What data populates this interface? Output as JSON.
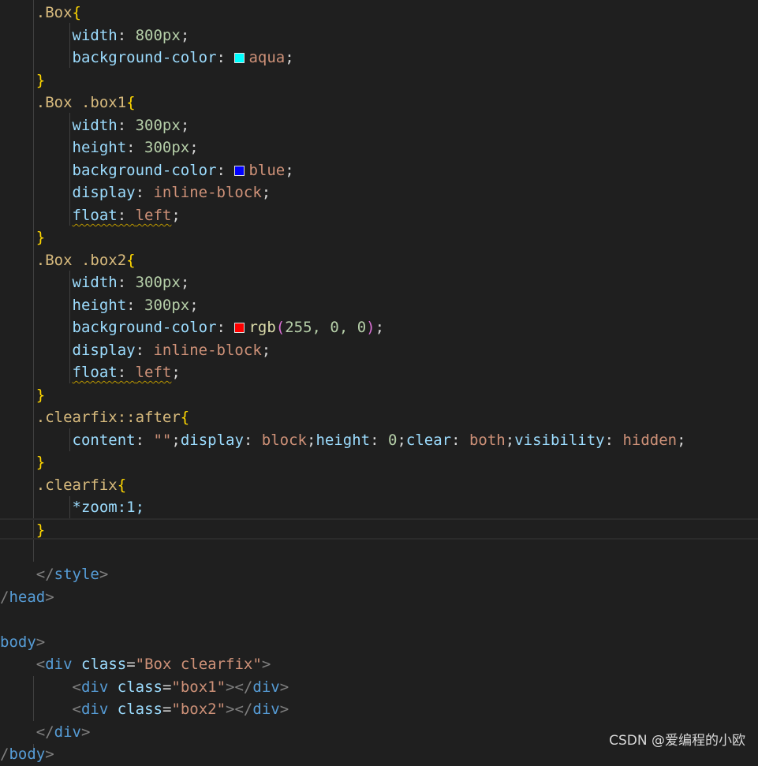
{
  "code": {
    "box_selector": ".Box",
    "width_prop": "width",
    "width_800": "800px",
    "bgcolor_prop": "background-color",
    "aqua": "aqua",
    "box1_selector": ".Box .box1",
    "height_prop": "height",
    "v300": "300px",
    "blue": "blue",
    "display_prop": "display",
    "inline_block": "inline-block",
    "float_prop": "float",
    "left": "left",
    "box2_selector": ".Box .box2",
    "rgb_fn": "rgb",
    "rgb_args": "255, 0, 0",
    "clearfix_after_selector": ".clearfix::after",
    "content_prop": "content",
    "empty_str": "\"\"",
    "block": "block",
    "zero": "0",
    "clear_prop": "clear",
    "both": "both",
    "visibility_prop": "visibility",
    "hidden": "hidden",
    "clearfix_selector": ".clearfix",
    "zoom_line": "*zoom:1;",
    "style_tag": "style",
    "head_tag": "head",
    "body_tag": "body",
    "div_tag": "div",
    "class_attr": "class",
    "box_clearfix_val": "\"Box clearfix\"",
    "box1_val": "\"box1\"",
    "box2_val": "\"box2\""
  },
  "swatches": {
    "aqua": "#00ffff",
    "blue": "#0000ff",
    "red": "#ff0000"
  },
  "watermark": "CSDN @爱编程的小欧"
}
